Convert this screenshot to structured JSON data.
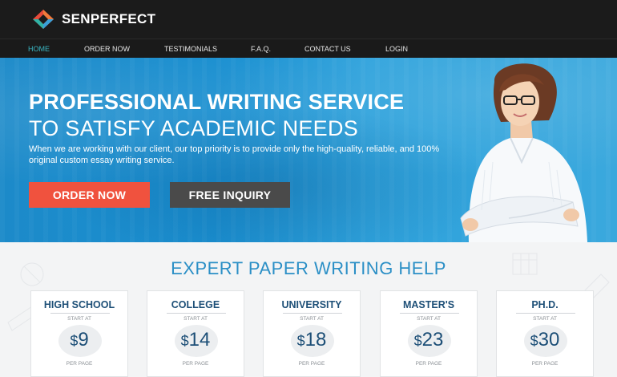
{
  "header": {
    "brand": "SENPERFECT",
    "logo_icon": "diamond-logo-icon"
  },
  "nav": {
    "items": [
      {
        "label": "HOME",
        "active": true
      },
      {
        "label": "ORDER NOW",
        "active": false
      },
      {
        "label": "TESTIMONIALS",
        "active": false
      },
      {
        "label": "F.A.Q.",
        "active": false
      },
      {
        "label": "CONTACT US",
        "active": false
      },
      {
        "label": "LOGIN",
        "active": false
      }
    ]
  },
  "hero": {
    "title_line1": "PROFESSIONAL WRITING SERVICE",
    "title_line2": "TO SATISFY ACADEMIC NEEDS",
    "description": "When we are working with our client, our top priority is to provide only the high-quality, reliable, and 100% original custom essay writing service.",
    "order_button": "ORDER NOW",
    "inquiry_button": "FREE INQUIRY"
  },
  "pricing": {
    "title": "EXPERT PAPER WRITING HELP",
    "cards": [
      {
        "level": "HIGH SCHOOL",
        "start_label": "START AT",
        "currency": "$",
        "price": "9",
        "per_label": "PER PAGE"
      },
      {
        "level": "COLLEGE",
        "start_label": "START AT",
        "currency": "$",
        "price": "14",
        "per_label": "PER PAGE"
      },
      {
        "level": "UNIVERSITY",
        "start_label": "START AT",
        "currency": "$",
        "price": "18",
        "per_label": "PER PAGE"
      },
      {
        "level": "MASTER'S",
        "start_label": "START AT",
        "currency": "$",
        "price": "23",
        "per_label": "PER PAGE"
      },
      {
        "level": "PH.D.",
        "start_label": "START AT",
        "currency": "$",
        "price": "30",
        "per_label": "PER PAGE"
      }
    ]
  },
  "colors": {
    "accent_teal": "#3ab6c3",
    "hero_blue": "#1a8fd0",
    "order_red": "#f0523e",
    "inquiry_gray": "#4a4a4a",
    "price_navy": "#1d4f77"
  }
}
